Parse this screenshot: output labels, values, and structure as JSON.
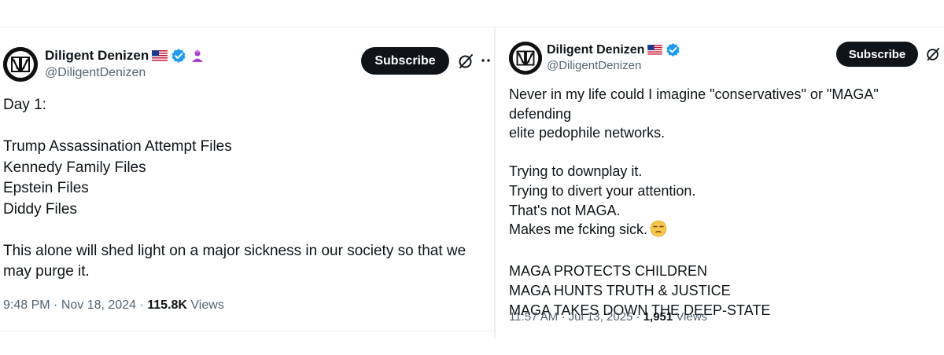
{
  "left_tweet": {
    "display_name": "Diligent Denizen",
    "flag": "🇺🇸",
    "handle": "@DiligentDenizen",
    "subscribe_label": "Subscribe",
    "body": "Day 1:\n\nTrump Assassination Attempt Files\nKennedy Family Files\nEpstein Files\nDiddy Files\n\nThis alone will shed light on a major sickness in our society so that we\nmay purge it.",
    "time": "9:48 PM",
    "date": "Nov 18, 2024",
    "views_count": "115.8K",
    "views_label": "Views",
    "separator": "·"
  },
  "right_tweet": {
    "display_name": "Diligent Denizen",
    "flag": "🇺🇸",
    "handle": "@DiligentDenizen",
    "subscribe_label": "Subscribe",
    "body_main": "Never in my life could I imagine \"conservatives\" or \"MAGA\" defending\nelite pedophile networks.\n\nTrying to downplay it.\nTrying to divert your attention.\nThat's not MAGA.\nMakes me fcking sick.",
    "body_emoji": "😒",
    "body_tail": "\n\nMAGA PROTECTS CHILDREN\nMAGA HUNTS TRUTH & JUSTICE\nMAGA TAKES DOWN THE DEEP-STATE",
    "time": "11:57 AM",
    "date": "Jul 13, 2025",
    "views_count": "1,951",
    "views_label": "Views",
    "separator": "·"
  },
  "colors": {
    "text": "#0f1419",
    "secondary": "#536471",
    "verified": "#1d9bf0",
    "affiliate": "#a544c8",
    "button": "#0f1419"
  },
  "icons": [
    "avatar-logo-icon",
    "us-flag-icon",
    "verified-badge-icon",
    "affiliate-badge-icon",
    "grok-icon",
    "more-icon",
    "unamused-face-emoji"
  ]
}
